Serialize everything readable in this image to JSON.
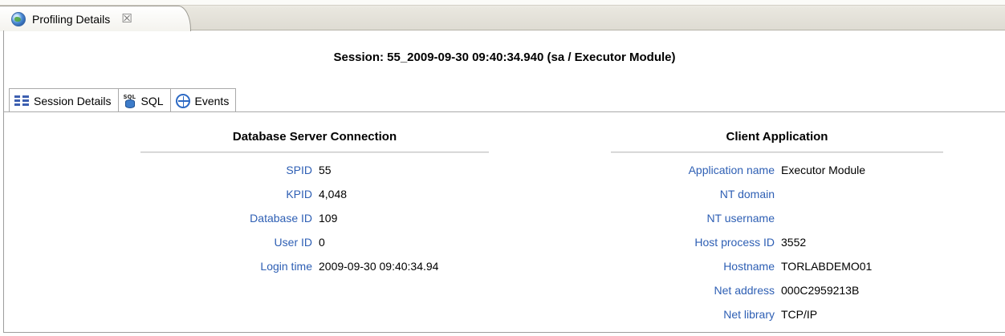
{
  "view_tab": {
    "label": "Profiling Details",
    "icon": "globe-icon",
    "close_glyph": "☒"
  },
  "session_title": "Session: 55_2009-09-30 09:40:34.940 (sa / Executor Module)",
  "tabs": [
    {
      "label": "Session Details",
      "icon": "list-icon",
      "active": true
    },
    {
      "label": "SQL",
      "icon": "sql-database-icon",
      "active": false
    },
    {
      "label": "Events",
      "icon": "events-icon",
      "active": false
    }
  ],
  "db_connection": {
    "title": "Database Server Connection",
    "fields": [
      {
        "label": "SPID",
        "value": "55"
      },
      {
        "label": "KPID",
        "value": "4,048"
      },
      {
        "label": "Database ID",
        "value": "109"
      },
      {
        "label": "User ID",
        "value": "0"
      },
      {
        "label": "Login time",
        "value": "2009-09-30 09:40:34.94"
      }
    ]
  },
  "client_application": {
    "title": "Client Application",
    "fields": [
      {
        "label": "Application name",
        "value": "Executor Module"
      },
      {
        "label": "NT domain",
        "value": ""
      },
      {
        "label": "NT username",
        "value": ""
      },
      {
        "label": "Host process ID",
        "value": "3552"
      },
      {
        "label": "Hostname",
        "value": "TORLABDEMO01"
      },
      {
        "label": "Net address",
        "value": "000C2959213B"
      },
      {
        "label": "Net library",
        "value": "TCP/IP"
      }
    ]
  },
  "colors": {
    "label_blue": "#2e5fb4",
    "icon_blue": "#2d6ac4"
  }
}
